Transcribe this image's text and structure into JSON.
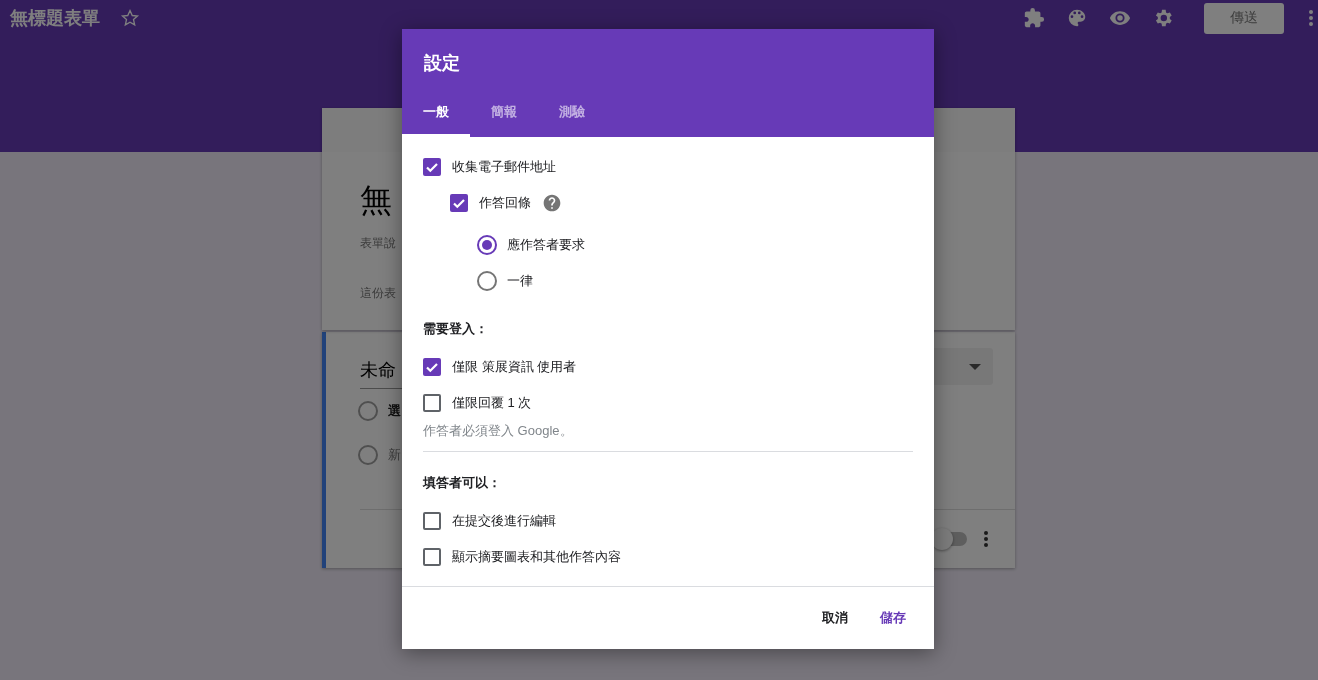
{
  "app_bar": {
    "title": "無標題表單",
    "starred": false,
    "send_button": "傳送"
  },
  "form": {
    "title": "無",
    "description": "表單說",
    "note": "這份表",
    "question": {
      "title": "未命",
      "options": [
        {
          "kind": "option",
          "label": "選"
        },
        {
          "kind": "add",
          "label": "新"
        }
      ],
      "required": {
        "on": false
      }
    }
  },
  "dialog": {
    "title": "設定",
    "tabs": [
      {
        "label": "一般",
        "selected": true
      },
      {
        "label": "簡報",
        "selected": false
      },
      {
        "label": "測驗",
        "selected": false
      }
    ],
    "sections": [
      {
        "items": [
          {
            "kind": "checkbox",
            "label": "收集電子郵件地址",
            "checked": true,
            "children": [
              {
                "kind": "checkbox",
                "label": "作答回條",
                "checked": true,
                "help": true,
                "children": [
                  {
                    "kind": "radio",
                    "label": "應作答者要求",
                    "selected": true
                  },
                  {
                    "kind": "radio",
                    "label": "一律",
                    "selected": false
                  }
                ]
              }
            ]
          }
        ]
      },
      {
        "heading": "需要登入：",
        "items": [
          {
            "kind": "checkbox",
            "label": "僅限 策展資訊 使用者",
            "checked": true
          },
          {
            "kind": "checkbox",
            "label": "僅限回覆 1 次",
            "checked": false
          },
          {
            "kind": "hint",
            "label": "作答者必須登入 Google。"
          }
        ]
      },
      {
        "heading": "填答者可以：",
        "items": [
          {
            "kind": "checkbox",
            "label": "在提交後進行編輯",
            "checked": false
          },
          {
            "kind": "checkbox",
            "label": "顯示摘要圖表和其他作答內容",
            "checked": false
          }
        ]
      }
    ],
    "buttons": [
      {
        "label": "取消",
        "primary": false
      },
      {
        "label": "儲存",
        "primary": true
      }
    ]
  }
}
